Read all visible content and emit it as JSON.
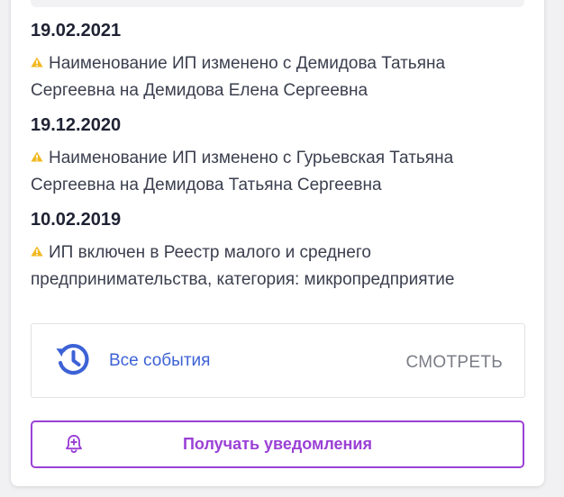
{
  "events": [
    {
      "date": "19.02.2021",
      "line1": "Наименование ИП изменено с Демидова Татьяна",
      "line2": "Сергеевна на Демидова Елена Сергеевна"
    },
    {
      "date": "19.12.2020",
      "line1": "Наименование ИП изменено с Гурьевская Татьяна",
      "line2": "Сергеевна на Демидова Татьяна Сергеевна"
    },
    {
      "date": "10.02.2019",
      "line1": "ИП включен в Реестр малого и среднего",
      "line2": "предпринимательства, категория: микропредприятие"
    }
  ],
  "all_events": {
    "label": "Все события",
    "action": "СМОТРЕТЬ",
    "icon": "history-icon"
  },
  "notify": {
    "label": "Получать уведомления",
    "icon": "bell-plus-icon"
  },
  "colors": {
    "warning": "#f2b821",
    "link_blue": "#3d62d6",
    "accent_purple": "#9b41d6",
    "date_text": "#1e2233",
    "body_text": "#3b3f4e",
    "muted": "#7b7d86"
  }
}
